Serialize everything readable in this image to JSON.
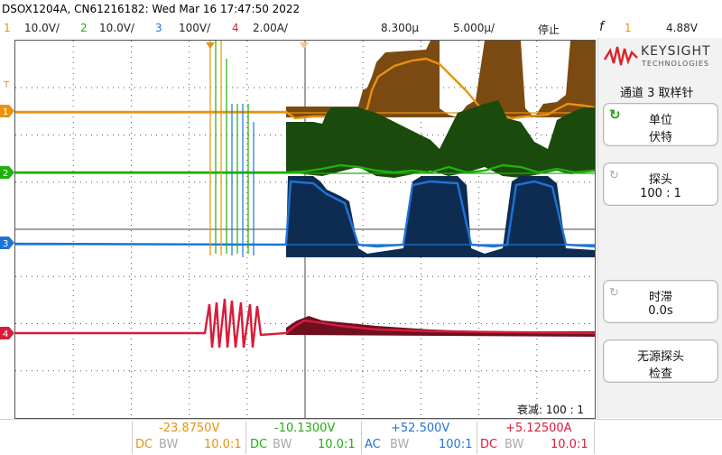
{
  "header": {
    "title": "DSOX1204A, CN61216182: Wed Mar 16 17:47:50 2022",
    "ch1_num": "1",
    "ch1_scale": "10.0V/",
    "ch2_num": "2",
    "ch2_scale": "10.0V/",
    "ch3_num": "3",
    "ch3_scale": "100V/",
    "ch4_num": "4",
    "ch4_scale": "2.00A/",
    "time_delay": "8.300µ",
    "time_scale": "5.000µ/",
    "run_state": "停止",
    "trigger_icon": "f",
    "trigger_source": "1",
    "trigger_level": "4.88V"
  },
  "panel": {
    "brand": "KEYSIGHT",
    "brand_sub": "TECHNOLOGIES",
    "title": "通道 3 取样针",
    "keys": [
      {
        "label": "单位",
        "value": "伏特"
      },
      {
        "label": "探头",
        "value": "100 : 1"
      },
      {
        "label": "时滞",
        "value": "0.0s"
      },
      {
        "label": "无源探头",
        "value": "检查"
      }
    ]
  },
  "screen": {
    "attenuation": "衰减: 100 : 1"
  },
  "footer": {
    "channels": [
      {
        "reading": "-23.8750V",
        "coupling": "DC",
        "bw": "BW",
        "ratio": "10.0:1"
      },
      {
        "reading": "-10.1300V",
        "coupling": "DC",
        "bw": "BW",
        "ratio": "10.0:1"
      },
      {
        "reading": "+52.500V",
        "coupling": "AC",
        "bw": "BW",
        "ratio": "100:1"
      },
      {
        "reading": "+5.12500A",
        "coupling": "DC",
        "bw": "BW",
        "ratio": "10.0:1"
      }
    ]
  },
  "colors": {
    "ch1": "#e8920f",
    "ch2": "#1fb00a",
    "ch3": "#1f73d6",
    "ch4": "#d91c3a",
    "ch1_fill": "#7a4a12",
    "ch2_fill": "#1a4a0c",
    "ch3_fill": "#0e2c52"
  },
  "icons": [
    "rotate-knob-icon",
    "trigger-rising-edge-icon",
    "keysight-logo-icon"
  ]
}
